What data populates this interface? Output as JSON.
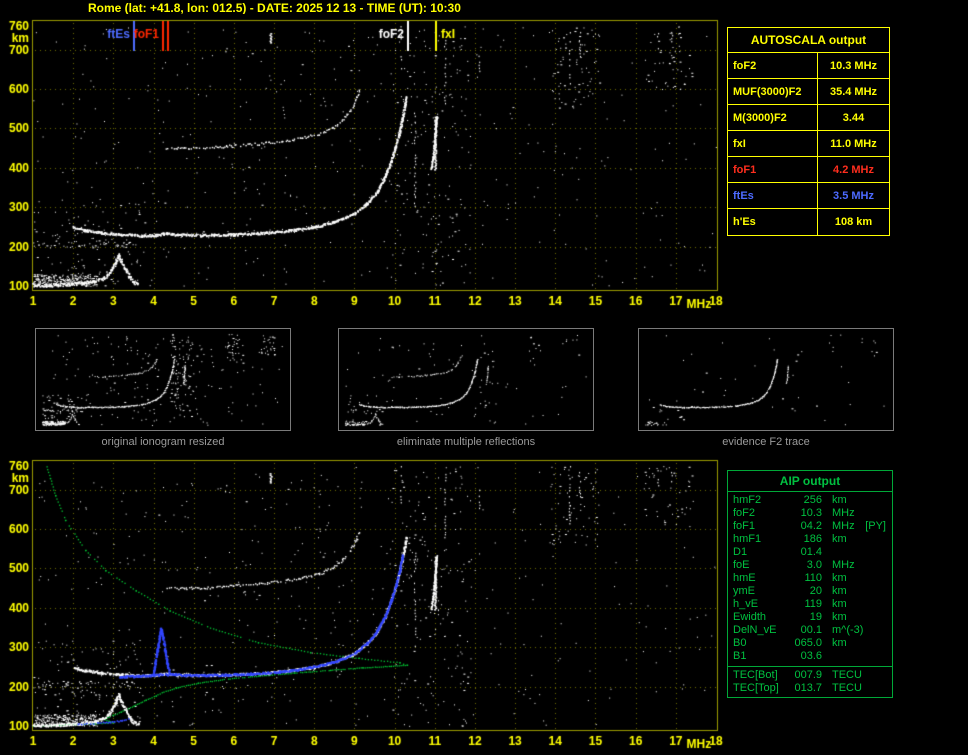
{
  "header": {
    "title": "Rome (lat: +41.8, lon: 012.5) - DATE: 2025 12 13 - TIME (UT): 10:30"
  },
  "colors": {
    "accent_yellow": "#ffff00",
    "accent_green": "#00c040",
    "accent_red": "#ff2e1e",
    "accent_blue": "#4d6bff",
    "trace_white": "#ffffff",
    "profile_green": "#00cc33",
    "restored_blue": "#3246ff",
    "caption_gray": "#9a9a9a",
    "frame_olive": "#9a9a00"
  },
  "autoscala": {
    "title": "AUTOSCALA output",
    "rows": [
      {
        "label": "foF2",
        "value": "10.3 MHz",
        "color": "#ffff00"
      },
      {
        "label": "MUF(3000)F2",
        "value": "35.4 MHz",
        "color": "#ffff00"
      },
      {
        "label": "M(3000)F2",
        "value": "3.44",
        "color": "#ffff00"
      },
      {
        "label": "fxI",
        "value": "11.0 MHz",
        "color": "#ffff00"
      },
      {
        "label": "foF1",
        "value": "4.2 MHz",
        "color": "#ff2e1e"
      },
      {
        "label": "ftEs",
        "value": "3.5 MHz",
        "color": "#4d6bff"
      },
      {
        "label": "h'Es",
        "value": "108  km",
        "color": "#ffff00"
      }
    ]
  },
  "thumbnails": [
    {
      "caption": "original ionogram resized"
    },
    {
      "caption": "eliminate multiple reflections"
    },
    {
      "caption": "evidence F2 trace"
    }
  ],
  "aip": {
    "title": "AIP output",
    "rows": [
      {
        "name": "hmF2",
        "value": "256",
        "unit": "km",
        "extra": ""
      },
      {
        "name": "foF2",
        "value": "10.3",
        "unit": "MHz",
        "extra": ""
      },
      {
        "name": "foF1",
        "value": "04.2",
        "unit": "MHz",
        "extra": "[PY]"
      },
      {
        "name": "hmF1",
        "value": "186",
        "unit": "km",
        "extra": ""
      },
      {
        "name": "D1",
        "value": "01.4",
        "unit": "",
        "extra": ""
      },
      {
        "name": "foE",
        "value": "3.0",
        "unit": "MHz",
        "extra": ""
      },
      {
        "name": "hmE",
        "value": "110",
        "unit": "km",
        "extra": ""
      },
      {
        "name": "ymE",
        "value": "20",
        "unit": "km",
        "extra": ""
      },
      {
        "name": "h_vE",
        "value": "119",
        "unit": "km",
        "extra": ""
      },
      {
        "name": "Ewidth",
        "value": "19",
        "unit": "km",
        "extra": ""
      },
      {
        "name": "DelN_vE",
        "value": "00.1",
        "unit": "m^(-3)",
        "extra": ""
      },
      {
        "name": "B0",
        "value": "065.0",
        "unit": "km",
        "extra": ""
      },
      {
        "name": "B1",
        "value": "03.6",
        "unit": "",
        "extra": ""
      },
      {
        "name": "TEC[Bot]",
        "value": "007.9",
        "unit": "TECU",
        "extra": ""
      },
      {
        "name": "TEC[Top]",
        "value": "013.7",
        "unit": "TECU",
        "extra": ""
      }
    ]
  },
  "chart_data": {
    "type": "scatter",
    "title": "Ionogram (virtual height vs sounding frequency) with AUTOSCALA interpretation",
    "x": {
      "label": "MHz",
      "min": 1,
      "max": 18,
      "ticks": [
        1,
        2,
        3,
        4,
        5,
        6,
        7,
        8,
        9,
        10,
        11,
        12,
        13,
        14,
        15,
        16,
        17,
        18
      ]
    },
    "y": {
      "label": "km",
      "min": 100,
      "max": 760,
      "ticks": [
        760,
        700,
        600,
        500,
        400,
        300,
        200,
        100
      ],
      "gridlines": [
        200,
        300,
        400,
        500,
        600,
        700
      ]
    },
    "axis_color": "#ffff00",
    "grid_color": "#6e6e00",
    "frame_color": "#9a9a00",
    "scaled_values": {
      "foF2_MHz": 10.3,
      "MUF3000F2_MHz": 35.4,
      "M3000F2": 3.44,
      "fxI_MHz": 11.0,
      "foF1_MHz": 4.2,
      "ftEs_MHz": 3.5,
      "hEs_km": 108
    },
    "profile_values": {
      "hmF2_km": 256,
      "foF2_MHz": 10.3,
      "foF1_MHz": 4.2,
      "hmF1_km": 186,
      "D1": 1.4,
      "foE_MHz": 3.0,
      "hmE_km": 110,
      "ymE_km": 20,
      "h_vE_km": 119,
      "Ewidth_km": 19,
      "DelN_vE": 0.1,
      "B0_km": 65.0,
      "B1": 3.6,
      "TEC_bot_TECU": 7.9,
      "TEC_top_TECU": 13.7
    },
    "markers": [
      {
        "label": "ftEs",
        "f": 3.5,
        "color": "#4d6bff",
        "side": "left",
        "double": false
      },
      {
        "label": "foF1",
        "f": 4.2,
        "color": "#ff2600",
        "side": "left",
        "double": true
      },
      {
        "label": "foF2",
        "f": 10.3,
        "color": "#ffffff",
        "side": "left",
        "double": false
      },
      {
        "label": "fxI",
        "f": 11.0,
        "color": "#ffff00",
        "side": "right",
        "double": false
      }
    ],
    "traces": {
      "f1_hop": [
        [
          2.0,
          250
        ],
        [
          2.3,
          242
        ],
        [
          2.7,
          236
        ],
        [
          3.2,
          232
        ],
        [
          3.7,
          229
        ],
        [
          4.05,
          230
        ],
        [
          4.25,
          234
        ],
        [
          4.6,
          231
        ],
        [
          5.2,
          230
        ],
        [
          6.0,
          232
        ],
        [
          6.8,
          236
        ],
        [
          7.4,
          242
        ],
        [
          8.0,
          251
        ],
        [
          8.5,
          264
        ],
        [
          9.0,
          286
        ],
        [
          9.3,
          310
        ],
        [
          9.55,
          340
        ],
        [
          9.75,
          378
        ],
        [
          9.9,
          418
        ],
        [
          10.0,
          450
        ],
        [
          10.1,
          485
        ],
        [
          10.18,
          525
        ],
        [
          10.25,
          562
        ],
        [
          10.28,
          580
        ]
      ],
      "f2_hop": [
        [
          4.3,
          450
        ],
        [
          4.8,
          451
        ],
        [
          5.4,
          453
        ],
        [
          6.0,
          457
        ],
        [
          6.6,
          462
        ],
        [
          7.2,
          469
        ],
        [
          7.7,
          477
        ],
        [
          8.1,
          487
        ],
        [
          8.45,
          502
        ],
        [
          8.7,
          522
        ],
        [
          8.9,
          548
        ],
        [
          9.05,
          578
        ],
        [
          9.12,
          600
        ]
      ],
      "es": [
        [
          1.0,
          104
        ],
        [
          1.3,
          103
        ],
        [
          1.6,
          104
        ],
        [
          1.9,
          106
        ],
        [
          2.2,
          108
        ],
        [
          2.5,
          112
        ],
        [
          2.7,
          118
        ],
        [
          2.85,
          129
        ],
        [
          2.95,
          143
        ],
        [
          3.05,
          161
        ],
        [
          3.12,
          180
        ],
        [
          3.2,
          161
        ],
        [
          3.3,
          141
        ],
        [
          3.4,
          123
        ],
        [
          3.5,
          111
        ],
        [
          3.62,
          105
        ]
      ],
      "x_tip": [
        [
          10.9,
          398
        ],
        [
          10.95,
          428
        ],
        [
          10.98,
          458
        ],
        [
          11.0,
          488
        ],
        [
          11.02,
          514
        ],
        [
          11.04,
          532
        ]
      ]
    },
    "green_profile": {
      "bottomside": [
        [
          1.0,
          101
        ],
        [
          1.5,
          103
        ],
        [
          2.0,
          105
        ],
        [
          2.5,
          107
        ],
        [
          2.85,
          109
        ],
        [
          3.0,
          110
        ],
        [
          2.88,
          114
        ],
        [
          2.78,
          118
        ],
        [
          2.84,
          123
        ],
        [
          2.98,
          128
        ],
        [
          3.18,
          137
        ],
        [
          3.5,
          152
        ],
        [
          3.8,
          167
        ],
        [
          4.05,
          178
        ],
        [
          4.2,
          186
        ],
        [
          4.55,
          198
        ],
        [
          5.1,
          210
        ],
        [
          5.8,
          220
        ],
        [
          6.6,
          228
        ],
        [
          7.5,
          236
        ],
        [
          8.4,
          243
        ],
        [
          9.2,
          249
        ],
        [
          9.9,
          253
        ],
        [
          10.3,
          256
        ]
      ],
      "topside": [
        [
          10.3,
          256
        ],
        [
          10.12,
          262
        ],
        [
          9.1,
          273
        ],
        [
          7.9,
          288
        ],
        [
          6.6,
          313
        ],
        [
          5.4,
          350
        ],
        [
          4.4,
          394
        ],
        [
          3.55,
          445
        ],
        [
          2.8,
          496
        ],
        [
          2.3,
          547
        ],
        [
          1.8,
          623
        ],
        [
          1.55,
          686
        ],
        [
          1.42,
          730
        ],
        [
          1.33,
          760
        ]
      ]
    },
    "blue_trace": {
      "main": [
        [
          3.15,
          227
        ],
        [
          3.5,
          228
        ],
        [
          3.8,
          229
        ],
        [
          4.0,
          231
        ],
        [
          4.45,
          233
        ],
        [
          4.8,
          231
        ],
        [
          5.2,
          230
        ],
        [
          5.8,
          231
        ],
        [
          6.4,
          234
        ],
        [
          7.0,
          238
        ],
        [
          7.6,
          245
        ],
        [
          8.1,
          254
        ],
        [
          8.6,
          268
        ],
        [
          9.0,
          287
        ],
        [
          9.3,
          311
        ],
        [
          9.55,
          342
        ],
        [
          9.75,
          380
        ],
        [
          9.9,
          420
        ],
        [
          10.02,
          460
        ],
        [
          10.12,
          500
        ],
        [
          10.18,
          535
        ]
      ],
      "cusp": [
        [
          3.98,
          232
        ],
        [
          4.03,
          262
        ],
        [
          4.08,
          295
        ],
        [
          4.13,
          326
        ],
        [
          4.17,
          350
        ],
        [
          4.22,
          326
        ],
        [
          4.27,
          295
        ],
        [
          4.32,
          262
        ],
        [
          4.38,
          236
        ]
      ],
      "e_region": [
        [
          2.1,
          106
        ],
        [
          2.5,
          108
        ],
        [
          2.9,
          111
        ],
        [
          3.2,
          115
        ],
        [
          3.35,
          119
        ]
      ]
    },
    "streaks": [
      {
        "f": 11.0,
        "h0": 395,
        "h1": 530,
        "w": 2,
        "solid": true
      },
      {
        "f": 6.9,
        "h0": 718,
        "h1": 742,
        "w": 2,
        "solid": true
      },
      {
        "f": 10.15,
        "h0": 640,
        "h1": 760,
        "w": 1,
        "solid": false
      },
      {
        "f": 10.5,
        "h0": 300,
        "h1": 540,
        "w": 1,
        "solid": false
      },
      {
        "f": 11.25,
        "h0": 560,
        "h1": 740,
        "w": 1,
        "solid": false
      },
      {
        "f": 12.1,
        "h0": 640,
        "h1": 700,
        "w": 1,
        "solid": false
      },
      {
        "f": 14.35,
        "h0": 615,
        "h1": 760,
        "w": 1,
        "solid": false
      },
      {
        "f": 14.6,
        "h0": 680,
        "h1": 745,
        "w": 1,
        "solid": false
      },
      {
        "f": 16.55,
        "h0": 700,
        "h1": 750,
        "w": 1,
        "solid": false
      },
      {
        "f": 16.9,
        "h0": 715,
        "h1": 745,
        "w": 1,
        "solid": false
      },
      {
        "f": 5.8,
        "h0": 690,
        "h1": 712,
        "w": 1,
        "solid": false
      }
    ],
    "noise": {
      "uniform": 330,
      "bands": [
        {
          "f0": 9.9,
          "f1": 11.9,
          "h0": 100,
          "h1": 760,
          "count": 150
        },
        {
          "f0": 13.9,
          "f1": 15.1,
          "h0": 550,
          "h1": 760,
          "count": 60
        },
        {
          "f0": 16.2,
          "f1": 17.4,
          "h0": 600,
          "h1": 760,
          "count": 45
        },
        {
          "f0": 1.0,
          "f1": 2.6,
          "h0": 100,
          "h1": 130,
          "count": 260
        },
        {
          "f0": 1.0,
          "f1": 3.8,
          "h0": 100,
          "h1": 320,
          "count": 110
        },
        {
          "f0": 1.0,
          "f1": 3.6,
          "h0": 198,
          "h1": 216,
          "count": 45
        },
        {
          "f0": 4.0,
          "f1": 9.5,
          "h0": 100,
          "h1": 760,
          "count": 60
        }
      ]
    }
  }
}
